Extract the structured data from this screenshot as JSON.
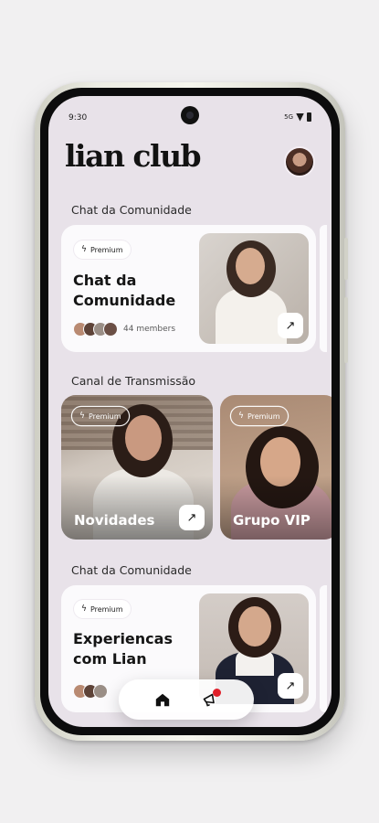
{
  "status": {
    "time": "9:30",
    "network": "5G"
  },
  "app": {
    "title": "lian club"
  },
  "sections": [
    {
      "title": "Chat da Comunidade"
    },
    {
      "title": "Canal de Transmissão"
    },
    {
      "title": "Chat da Comunidade"
    }
  ],
  "chat_card": {
    "badge": "Premium",
    "title_line1": "Chat da",
    "title_line2": "Comunidade",
    "members": "44 members"
  },
  "tiles": [
    {
      "badge": "Premium",
      "label": "Novidades"
    },
    {
      "badge": "Premium",
      "label": "Grupo VIP"
    }
  ],
  "exp_card": {
    "badge": "Premium",
    "title_line1": "Experiencas",
    "title_line2": "com Lian"
  },
  "icons": {
    "arrow": "↗",
    "bolt": "ϟ",
    "home": "home-icon",
    "megaphone": "megaphone-icon"
  },
  "colors": {
    "screen_bg": "#e8e2e9",
    "card_bg": "#fbfafc",
    "notification_dot": "#e0202a"
  }
}
